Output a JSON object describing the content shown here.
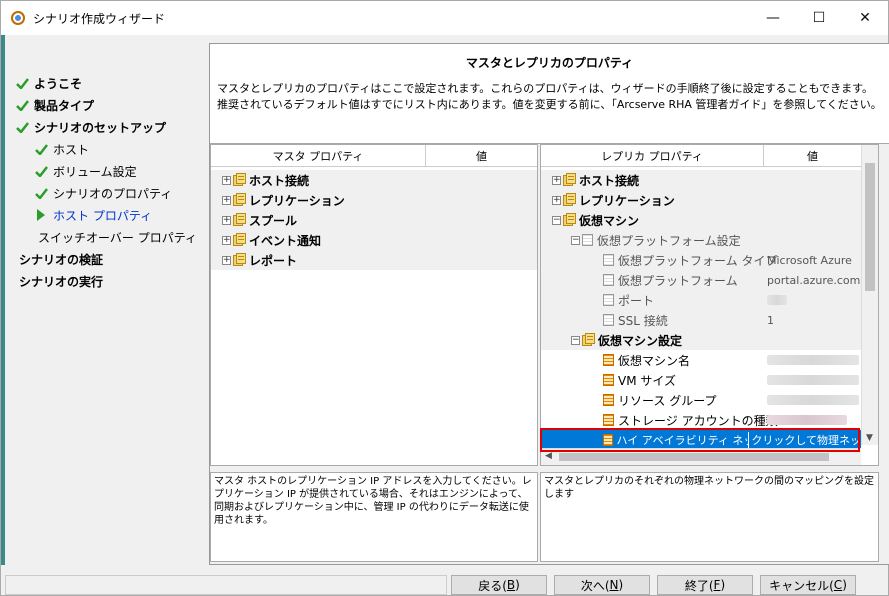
{
  "window": {
    "title": "シナリオ作成ウィザード",
    "controls": {
      "minimize": "—",
      "maximize": "☐",
      "close": "✕"
    }
  },
  "nav": {
    "items": [
      {
        "label": "ようこそ",
        "state": "done"
      },
      {
        "label": "製品タイプ",
        "state": "done"
      },
      {
        "label": "シナリオのセットアップ",
        "state": "done"
      },
      {
        "label": "ホスト",
        "state": "done"
      },
      {
        "label": "ボリューム設定",
        "state": "done"
      },
      {
        "label": "シナリオのプロパティ",
        "state": "done"
      },
      {
        "label": "ホスト プロパティ",
        "state": "current"
      },
      {
        "label": "スイッチオーバー プロパティ",
        "state": "pending"
      },
      {
        "label": "シナリオの検証",
        "state": "pending"
      },
      {
        "label": "シナリオの実行",
        "state": "pending"
      }
    ]
  },
  "header": {
    "title": "マスタとレプリカのプロパティ",
    "line1": "マスタとレプリカのプロパティはここで設定されます。これらのプロパティは、ウィザードの手順終了後に設定することもできます。",
    "line2": "推奨されているデフォルト値はすでにリスト内にあります。値を変更する前に、「Arcserve RHA 管理者ガイド」を参照してください。"
  },
  "master": {
    "col_property": "マスタ プロパティ",
    "col_value": "値",
    "groups": [
      "ホスト接続",
      "レプリケーション",
      "スプール",
      "イベント通知",
      "レポート"
    ],
    "description": "マスタ ホストのレプリケーション IP アドレスを入力してください。レプリケーション IP が提供されている場合、それはエンジンによって、同期およびレプリケーション中に、管理 IP の代わりにデータ転送に使用されます。"
  },
  "replica": {
    "col_property": "レプリカ プロパティ",
    "col_value": "値",
    "groups": {
      "host_connection": "ホスト接続",
      "replication": "レプリケーション",
      "virtual_machine": "仮想マシン",
      "platform_settings": "仮想プラットフォーム設定",
      "platform_type": "仮想プラットフォーム タイプ",
      "platform_type_value": "Microsoft Azure",
      "platform": "仮想プラットフォーム",
      "platform_value": "portal.azure.com",
      "port": "ポート",
      "ssl": "SSL 接続",
      "ssl_value": "1",
      "vm_settings": "仮想マシン設定",
      "vm_name": "仮想マシン名",
      "vm_size": "VM サイズ",
      "resource_group": "リソース グループ",
      "storage_type": "ストレージ アカウントの種類",
      "ha_network": "ハイ アベイラビリティ ネットワーク...",
      "ha_network_value": "クリックして物理ネッ"
    },
    "description": "マスタとレプリカのそれぞれの物理ネットワークの間のマッピングを設定します"
  },
  "footer": {
    "back": "戻る(",
    "back_key": "B",
    "back_end": ")",
    "next": "次へ(",
    "next_key": "N",
    "next_end": ")",
    "finish": "終了(",
    "finish_key": "F",
    "finish_end": ")",
    "cancel": "キャンセル(",
    "cancel_key": "C",
    "cancel_end": ")"
  },
  "colors": {
    "accent": "#0078d7",
    "highlight": "#e00000",
    "check": "#2a9d2a"
  }
}
